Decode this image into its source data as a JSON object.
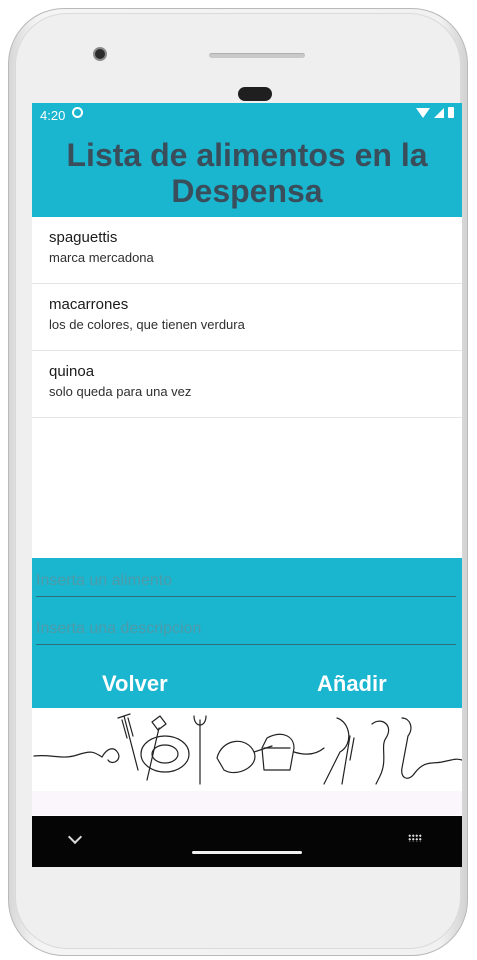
{
  "statusbar": {
    "time": "4:20"
  },
  "header": {
    "title": "Lista de alimentos en la Despensa"
  },
  "list": {
    "items": [
      {
        "name": "spaguettis",
        "description": "marca mercadona"
      },
      {
        "name": "macarrones",
        "description": "los de colores, que tienen verdura"
      },
      {
        "name": "quinoa",
        "description": "solo queda para una vez"
      }
    ]
  },
  "form": {
    "food_placeholder": "Inserta un alimento",
    "description_placeholder": "Inserta una descripcion",
    "back_label": "Volver",
    "add_label": "Añadir"
  },
  "colors": {
    "accent": "#1ab5cf",
    "title_text": "#3a4d5a"
  },
  "icons": [
    "sync-icon",
    "wifi-icon",
    "signal-icon",
    "battery-icon",
    "nav-back-icon",
    "nav-home-bar",
    "keyboard-icon"
  ]
}
